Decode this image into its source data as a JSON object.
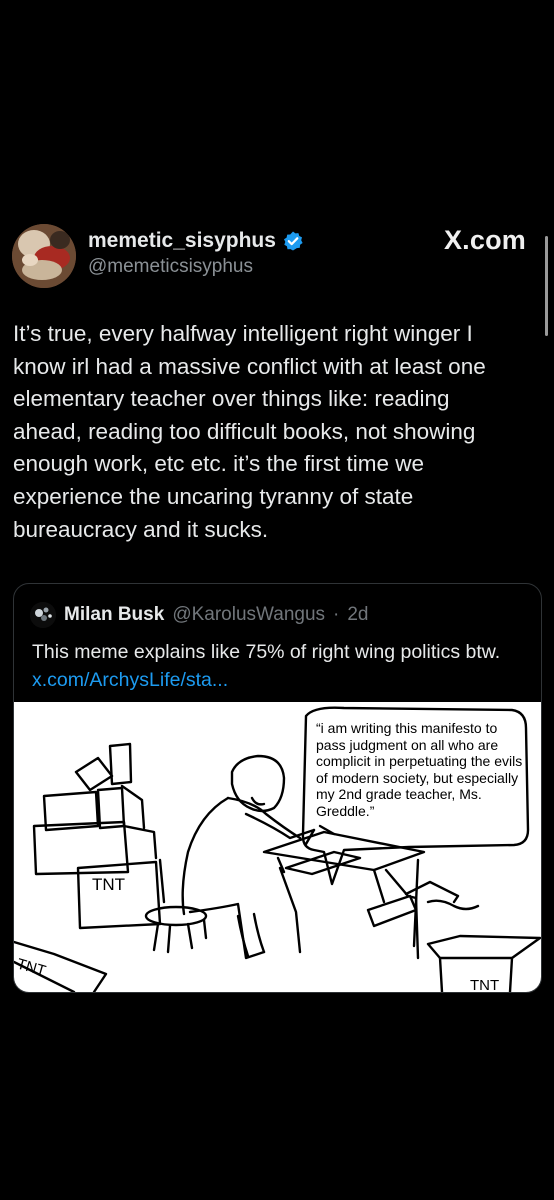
{
  "post": {
    "author": {
      "display_name": "memetic_sisyphus",
      "handle": "@memeticsisyphus",
      "verified": true,
      "avatar_icon": "avatar-painting-icon"
    },
    "watermark": "X.com",
    "text": "It’s true, every halfway intelligent right winger I\nknow irl had a massive conflict with at least one\nelementary teacher over things like: reading\nahead, reading too difficult books, not showing\nenough work, etc etc. it’s the first time we\nexperience the uncaring tyranny of state\nbureaucracy and it sucks.",
    "quoted": {
      "display_name": "Milan Busk",
      "handle": "@KarolusWangus",
      "separator": "·",
      "time": "2d",
      "text": "This meme explains like 75% of right wing politics btw.",
      "link": "x.com/ArchysLife/sta...",
      "image": {
        "speech_bubble": "“i am writing this manifesto to pass judgment on all who are complicit in perpetuating the evils of modern society, but especially my 2nd grade teacher, Ms. Greddle.”",
        "box_labels": [
          "TNT",
          "TNT",
          "TNT"
        ]
      }
    }
  },
  "colors": {
    "background": "#000000",
    "text": "#e7e9ea",
    "secondary_text": "#8b9196",
    "link": "#1d9bf0",
    "verified_badge": "#1d9bf0"
  }
}
